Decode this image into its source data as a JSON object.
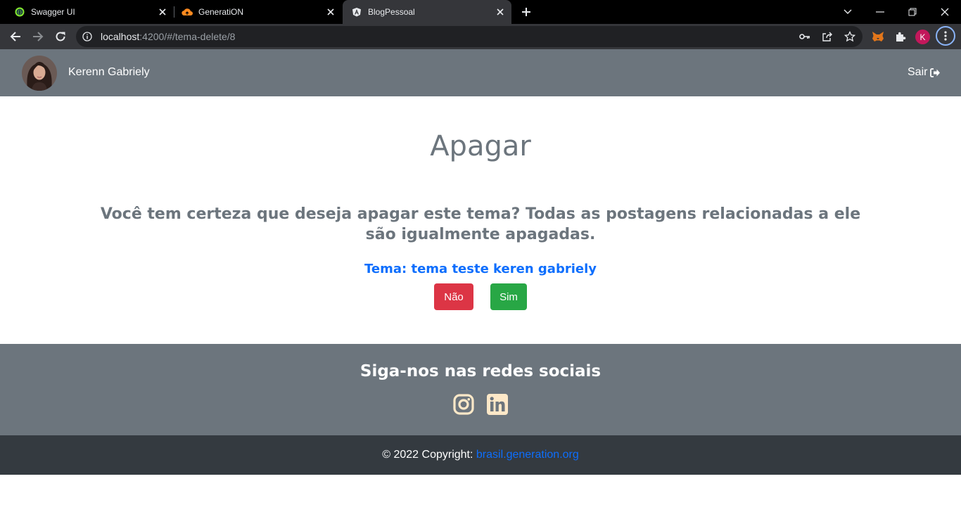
{
  "browser": {
    "tabs": [
      {
        "title": "Swagger UI",
        "icon": "swagger-icon"
      },
      {
        "title": "GeneratiON",
        "icon": "cloud-icon"
      },
      {
        "title": "BlogPessoal",
        "icon": "angular-icon",
        "active": true
      }
    ],
    "address": {
      "host": "localhost",
      "path": ":4200/#/tema-delete/8"
    },
    "profile_initial": "K"
  },
  "navbar": {
    "username": "Kerenn Gabriely",
    "logout_label": "Sair"
  },
  "main": {
    "title": "Apagar",
    "question": "Você tem certeza que deseja apagar este tema? Todas as postagens relacionadas a ele são igualmente apagadas.",
    "tema_label": "Tema: tema teste keren gabriely",
    "buttons": {
      "no": "Não",
      "yes": "Sim"
    }
  },
  "footer": {
    "follow_title": "Siga-nos nas redes sociais",
    "social": [
      "instagram-icon",
      "linkedin-icon"
    ],
    "copyright_prefix": "© 2022 Copyright:",
    "copyright_link": "brasil.generation.org"
  },
  "colors": {
    "navbar_bg": "#6c757d",
    "footer_bg": "#343a40",
    "link": "#0d6efd",
    "danger": "#dc3545",
    "success": "#28a745",
    "social_icon": "#fde8c8"
  }
}
